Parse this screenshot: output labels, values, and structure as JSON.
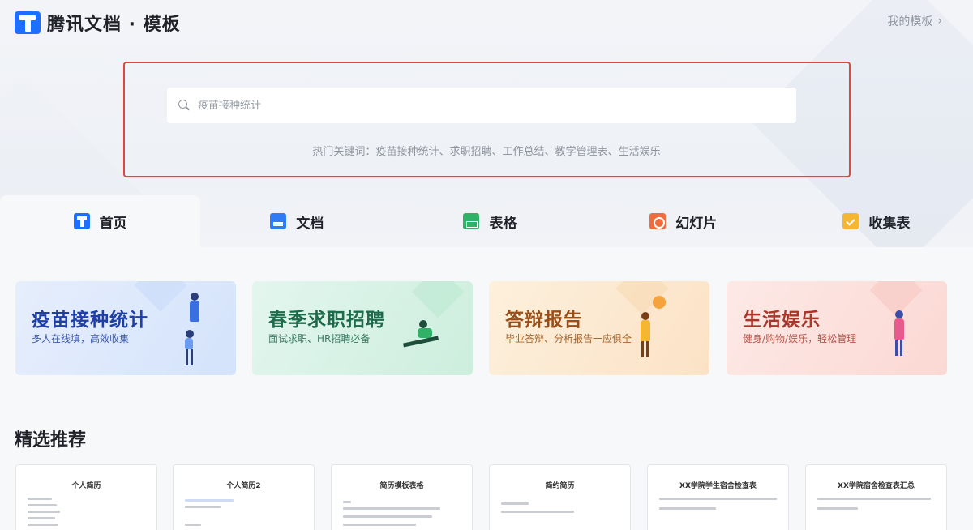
{
  "header": {
    "app_title": "腾讯文档 · 模板",
    "my_templates": "我的模板",
    "chevron": "›"
  },
  "search": {
    "placeholder": "疫苗接种统计",
    "hot_label": "热门关键词：",
    "hot_keywords": [
      "疫苗接种统计",
      "求职招聘",
      "工作总结",
      "教学管理表",
      "生活娱乐"
    ],
    "separator": "、"
  },
  "tabs": [
    {
      "label": "首页",
      "icon": "home-icon",
      "active": true
    },
    {
      "label": "文档",
      "icon": "doc-icon"
    },
    {
      "label": "表格",
      "icon": "sheet-icon"
    },
    {
      "label": "幻灯片",
      "icon": "slide-icon"
    },
    {
      "label": "收集表",
      "icon": "form-icon"
    }
  ],
  "banners": [
    {
      "title": "疫苗接种统计",
      "subtitle": "多人在线填，高效收集"
    },
    {
      "title": "春季求职招聘",
      "subtitle": "面试求职、HR招聘必备"
    },
    {
      "title": "答辩报告",
      "subtitle": "毕业答辩、分析报告一应俱全"
    },
    {
      "title": "生活娱乐",
      "subtitle": "健身/购物/娱乐，轻松管理"
    }
  ],
  "recommend": {
    "title": "精选推荐",
    "cards": [
      {
        "title": "个人简历"
      },
      {
        "title": "个人简历2"
      },
      {
        "title": "简历模板表格"
      },
      {
        "title": "简约简历"
      },
      {
        "title": "XX学院学生宿舍检查表"
      },
      {
        "title": "XX学院宿舍检查表汇总"
      }
    ]
  },
  "colors": {
    "brand": "#1e6fff",
    "highlight_frame": "#e0463b"
  }
}
